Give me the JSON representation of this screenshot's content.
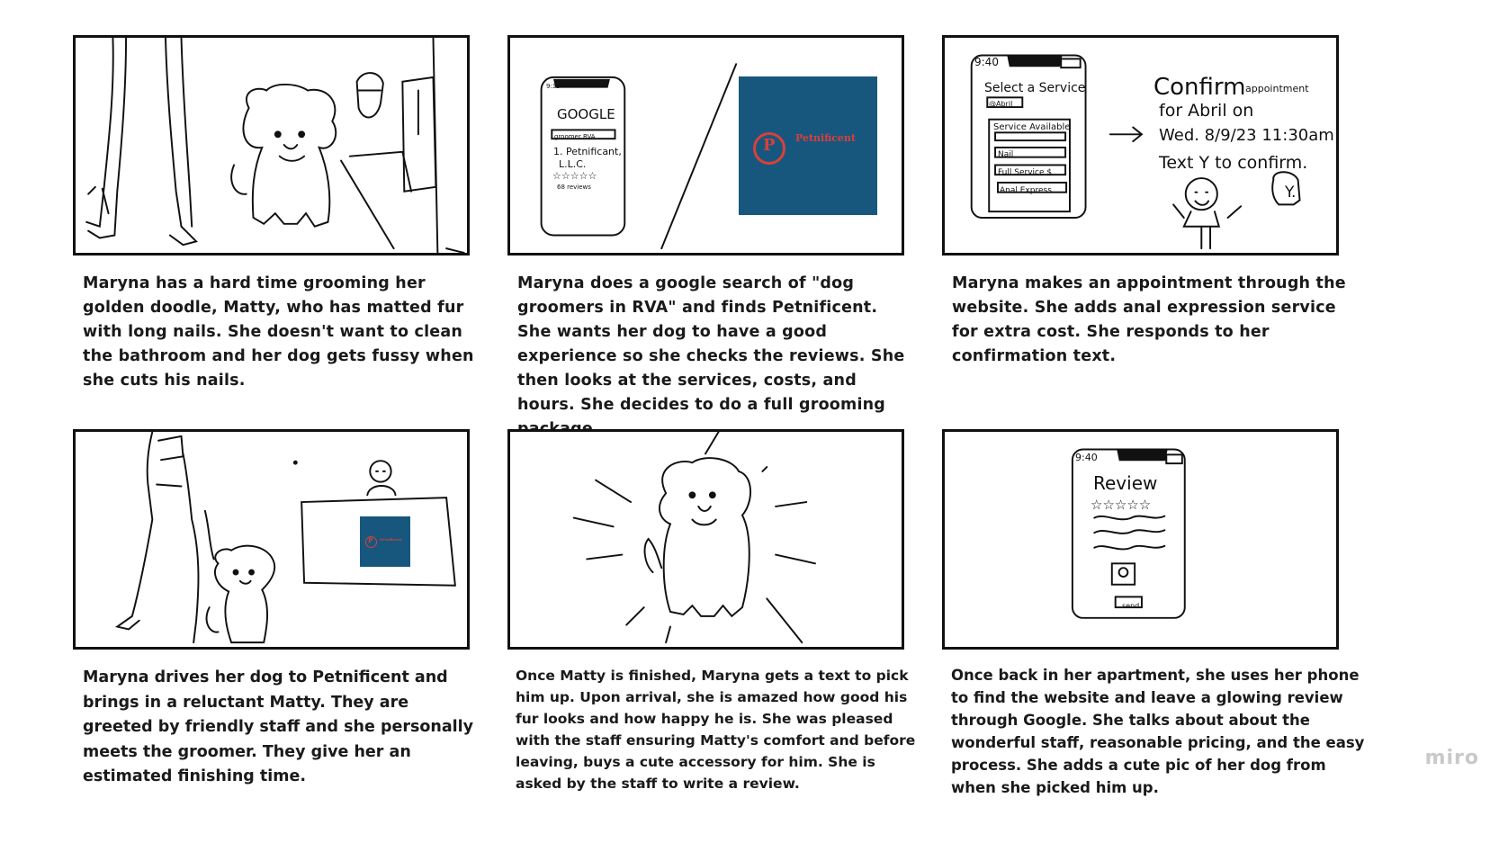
{
  "panels": [
    {
      "caption": "Maryna has a hard time grooming her golden doodle, Matty, who has matted fur with long nails. She doesn't want to clean the bathroom and her dog gets fussy when she cuts his nails."
    },
    {
      "caption": "Maryna does a google search of \"dog groomers in RVA\" and finds Petnificent. She wants her dog to have a good experience so she checks the reviews. She then looks at the services, costs, and hours. She decides to do a full grooming package.",
      "phone": {
        "time": "9:35",
        "google_label": "GOOGLE",
        "search_text": "groomer RVA",
        "result_line1": "1. Petnificant,",
        "result_line2": "L.L.C.",
        "stars": "☆☆☆☆☆",
        "reviews": "68 reviews"
      },
      "logo": {
        "letter": "P",
        "name": "Petnificent"
      }
    },
    {
      "caption": "Maryna makes an appointment through the website. She adds anal expression service for extra cost. She responds to her confirmation text.",
      "phone": {
        "time": "9:40",
        "title": "Select a Service",
        "tag": "@Abril",
        "fields": [
          "Service Available",
          "Nail",
          "Full Service  $",
          "Anal Express"
        ]
      },
      "text_msg": {
        "line1": "Confirm",
        "small": "appointment",
        "line2": "for Abril on",
        "line3": "Wed. 8/9/23 11:30am",
        "line4": "Text Y to confirm."
      },
      "reply": "Y."
    },
    {
      "caption": "Maryna drives her dog to Petnificent and brings in a reluctant Matty. They are greeted by friendly staff and she personally meets the groomer. They give her an estimated finishing time.",
      "logo": {
        "letter": "P",
        "name": "Petnificent"
      }
    },
    {
      "caption": "Once Matty is finished, Maryna gets a text to pick him up. Upon arrival, she is amazed how good his fur looks and how happy he is. She was pleased with the staff ensuring Matty's comfort and before leaving, buys a cute accessory for him. She is asked by the staff to write a review."
    },
    {
      "caption": "Once back in her apartment, she uses her phone to find the website and leave a glowing review through Google. She talks about about the wonderful staff, reasonable pricing, and the easy process. She adds a cute pic of her dog from when she picked him up.",
      "phone": {
        "time": "9:40",
        "title": "Review",
        "stars": "☆☆☆☆☆",
        "send": "send"
      }
    }
  ],
  "watermark": "miro",
  "colors": {
    "logo_bg": "#17577e",
    "logo_accent": "#d9403a",
    "ink": "#111111"
  }
}
